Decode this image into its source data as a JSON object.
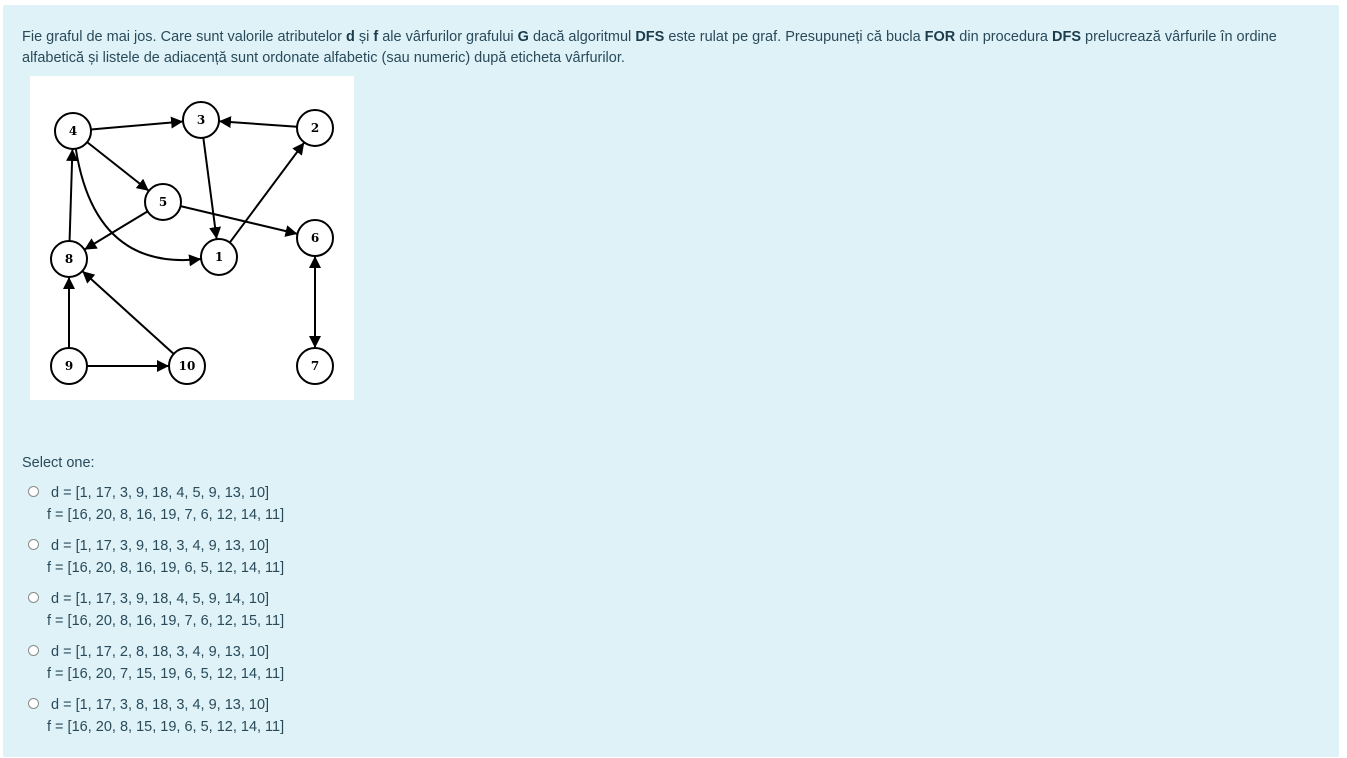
{
  "question": {
    "p1": "Fie graful de mai jos. Care sunt valorile atributelor ",
    "b1": "d",
    "p2": " și ",
    "b2": "f",
    "p3": " ale vârfurilor grafului ",
    "b3": "G",
    "p4": " dacă algoritmul ",
    "b4": "DFS",
    "p5": " este rulat pe graf. Presupuneți că bucla ",
    "b5": "FOR",
    "p6": " din procedura ",
    "b6": "DFS",
    "p7": " prelucrează vârfurile în ordine alfabetică și listele de adiacență sunt ordonate alfabetic (sau numeric) după eticheta vârfurilor."
  },
  "graph": {
    "nodes": [
      "1",
      "2",
      "3",
      "4",
      "5",
      "6",
      "7",
      "8",
      "9",
      "10"
    ],
    "edges": [
      [
        "4",
        "3"
      ],
      [
        "2",
        "3"
      ],
      [
        "3",
        "1"
      ],
      [
        "1",
        "2"
      ],
      [
        "4",
        "5"
      ],
      [
        "4",
        "1"
      ],
      [
        "5",
        "8"
      ],
      [
        "5",
        "6"
      ],
      [
        "8",
        "4"
      ],
      [
        "9",
        "8"
      ],
      [
        "9",
        "10"
      ],
      [
        "10",
        "8"
      ],
      [
        "6",
        "7"
      ],
      [
        "7",
        "6"
      ]
    ]
  },
  "select_label": "Select one:",
  "options": [
    {
      "d": "d = [1, 17, 3, 9, 18, 4, 5, 9, 13, 10]",
      "f": "f = [16, 20, 8, 16, 19, 7, 6, 12, 14, 11]"
    },
    {
      "d": "d = [1, 17, 3, 9, 18, 3, 4, 9, 13, 10]",
      "f": "f = [16, 20, 8, 16, 19, 6, 5, 12, 14, 11]"
    },
    {
      "d": "d = [1, 17, 3, 9, 18, 4, 5, 9, 14, 10]",
      "f": "f = [16, 20, 8, 16, 19, 7, 6, 12, 15, 11]"
    },
    {
      "d": "d = [1, 17, 2, 8, 18, 3, 4, 9, 13, 10]",
      "f": "f = [16, 20, 7, 15, 19, 6, 5, 12, 14, 11]"
    },
    {
      "d": "d = [1, 17, 3, 8, 18, 3, 4, 9, 13, 10]",
      "f": "f = [16, 20, 8, 15, 19, 6, 5, 12, 14, 11]"
    }
  ]
}
